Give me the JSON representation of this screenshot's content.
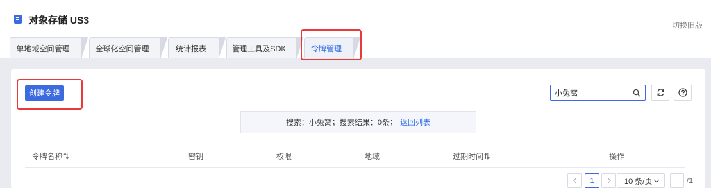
{
  "header": {
    "title": "对象存储 US3",
    "switch_old": "切换旧版"
  },
  "tabs": [
    {
      "label": "单地域空间管理",
      "active": false
    },
    {
      "label": "全球化空间管理",
      "active": false
    },
    {
      "label": "统计报表",
      "active": false
    },
    {
      "label": "管理工具及SDK",
      "active": false
    },
    {
      "label": "令牌管理",
      "active": true
    }
  ],
  "toolbar": {
    "create_label": "创建令牌",
    "search_value": "小兔窝",
    "icons": {
      "search": "search-icon",
      "refresh": "refresh-icon",
      "help": "help-icon"
    }
  },
  "notice": {
    "text": "搜索：小兔窝；搜索结果：0条；",
    "link": "返回列表"
  },
  "table": {
    "columns": [
      "令牌名称",
      "密钥",
      "权限",
      "地域",
      "过期时间",
      "操作"
    ]
  },
  "pagination": {
    "current_page": "1",
    "page_size": "10 条/页",
    "total": "/1"
  },
  "colors": {
    "accent": "#3c6be0",
    "highlight_box": "#e83a3a",
    "band": "#e9ebf0"
  }
}
